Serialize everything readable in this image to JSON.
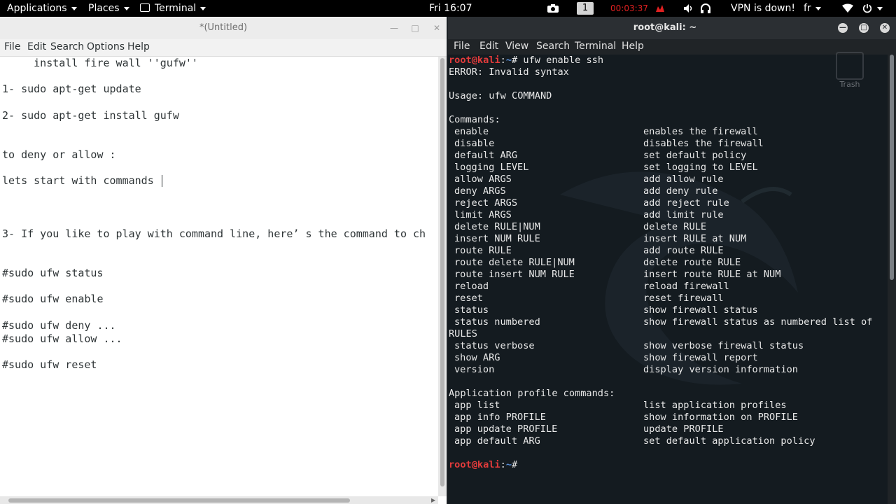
{
  "topbar": {
    "applications": "Applications",
    "places": "Places",
    "terminal": "Terminal",
    "clock": "Fri 16:07",
    "workspace": "1",
    "recording_timer": "00:03:37",
    "vpn_status": "VPN is down!",
    "keyboard_layout": "fr"
  },
  "gedit": {
    "title": "*(Untitled)",
    "menu": [
      "File",
      "Edit",
      "Search",
      "Options",
      "Help"
    ],
    "lines": [
      "     install fire wall ''gufw''",
      "1- sudo apt-get update",
      "2- sudo apt-get install gufw",
      "to deny or allow :",
      "lets start with commands ",
      "3- If you like to play with command line, here’ s the command to ch",
      "#sudo ufw status",
      "#sudo ufw enable",
      "#sudo ufw deny ...",
      "#sudo ufw allow ...",
      "#sudo ufw reset"
    ]
  },
  "terminal": {
    "title": "root@kali: ~",
    "menu": [
      "File",
      "Edit",
      "View",
      "Search",
      "Terminal",
      "Help"
    ],
    "prompt_user": "root@kali",
    "prompt_sep": ":",
    "prompt_path": "~",
    "prompt_end": "# ",
    "command": "ufw enable ssh",
    "error": "ERROR: Invalid syntax",
    "usage": "Usage: ufw COMMAND",
    "commands_header": "Commands:",
    "commands": [
      [
        "enable",
        "enables the firewall"
      ],
      [
        "disable",
        "disables the firewall"
      ],
      [
        "default ARG",
        "set default policy"
      ],
      [
        "logging LEVEL",
        "set logging to LEVEL"
      ],
      [
        "allow ARGS",
        "add allow rule"
      ],
      [
        "deny ARGS",
        "add deny rule"
      ],
      [
        "reject ARGS",
        "add reject rule"
      ],
      [
        "limit ARGS",
        "add limit rule"
      ],
      [
        "delete RULE|NUM",
        "delete RULE"
      ],
      [
        "insert NUM RULE",
        "insert RULE at NUM"
      ],
      [
        "route RULE",
        "add route RULE"
      ],
      [
        "route delete RULE|NUM",
        "delete route RULE"
      ],
      [
        "route insert NUM RULE",
        "insert route RULE at NUM"
      ],
      [
        "reload",
        "reload firewall"
      ],
      [
        "reset",
        "reset firewall"
      ],
      [
        "status",
        "show firewall status"
      ],
      [
        "status numbered",
        "show firewall status as numbered list of"
      ]
    ],
    "wrap_line": "RULES",
    "commands2": [
      [
        "status verbose",
        "show verbose firewall status"
      ],
      [
        "show ARG",
        "show firewall report"
      ],
      [
        "version",
        "display version information"
      ]
    ],
    "app_header": "Application profile commands:",
    "app_commands": [
      [
        "app list",
        "list application profiles"
      ],
      [
        "app info PROFILE",
        "show information on PROFILE"
      ],
      [
        "app update PROFILE",
        "update PROFILE"
      ],
      [
        "app default ARG",
        "set default application policy"
      ]
    ]
  },
  "desktop": {
    "trash_label": "Trash"
  }
}
